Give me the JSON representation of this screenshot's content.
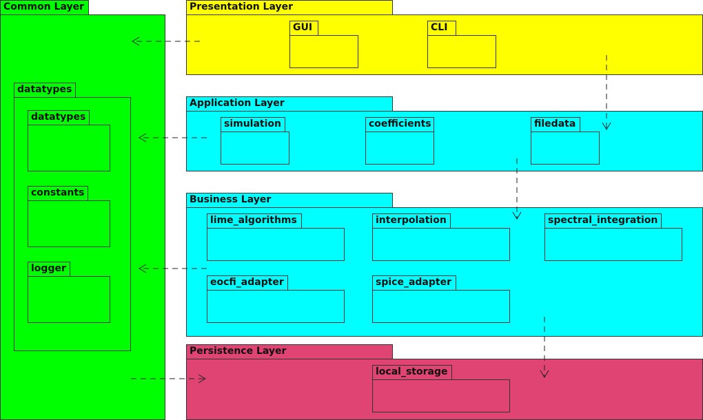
{
  "colors": {
    "common": "#00ff00",
    "presentation": "#ffff00",
    "application": "#00ffff",
    "business": "#00ffff",
    "persistence": "#e04472"
  },
  "common": {
    "title": "Common Layer",
    "datatypes_pkg": {
      "title": "datatypes",
      "children": [
        "datatypes",
        "constants",
        "logger"
      ]
    }
  },
  "presentation": {
    "title": "Presentation Layer",
    "packages": [
      "GUI",
      "CLI"
    ]
  },
  "application": {
    "title": "Application Layer",
    "packages": [
      "simulation",
      "coefficients",
      "filedata"
    ]
  },
  "business": {
    "title": "Business Layer",
    "packages": [
      "lime_algorithms",
      "interpolation",
      "spectral_integration",
      "eocfi_adapter",
      "spice_adapter"
    ]
  },
  "persistence": {
    "title": "Persistence Layer",
    "packages": [
      "local_storage"
    ]
  }
}
